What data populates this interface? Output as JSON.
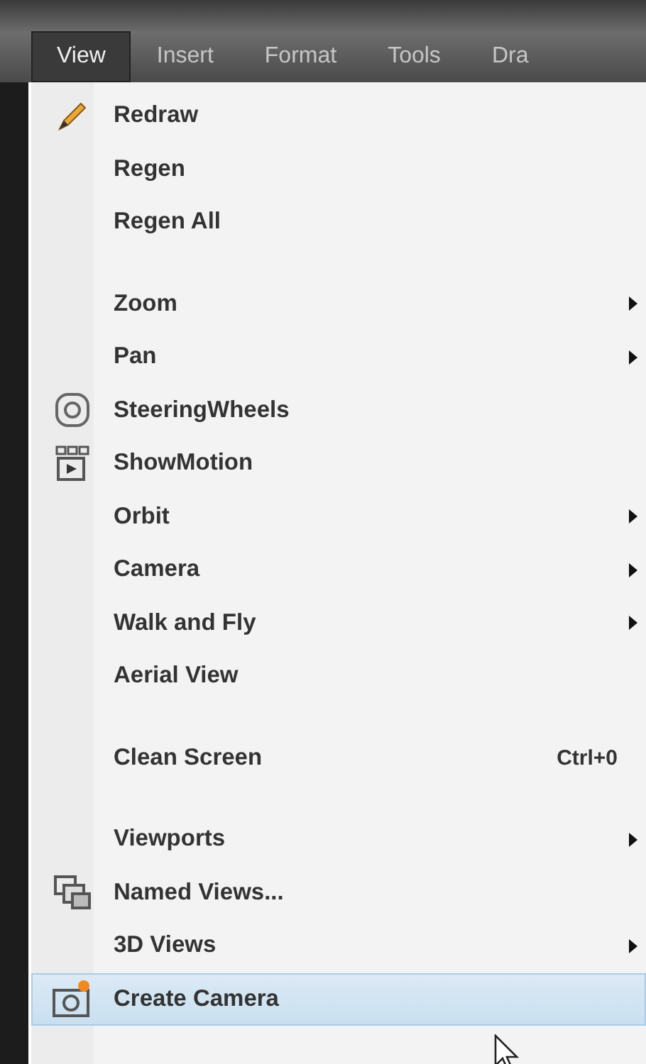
{
  "menubar": [
    {
      "label": "View",
      "selected": true
    },
    {
      "label": "Insert",
      "selected": false
    },
    {
      "label": "Format",
      "selected": false
    },
    {
      "label": "Tools",
      "selected": false
    },
    {
      "label": "Dra",
      "selected": false
    }
  ],
  "menu": {
    "items": [
      {
        "kind": "item",
        "label": "Redraw",
        "submenu": false,
        "selected": false
      },
      {
        "kind": "item",
        "label": "Regen",
        "submenu": false,
        "selected": false
      },
      {
        "kind": "item",
        "label": "Regen All",
        "submenu": false,
        "selected": false
      },
      {
        "kind": "separator"
      },
      {
        "kind": "item",
        "label": "Zoom",
        "submenu": true,
        "selected": false
      },
      {
        "kind": "item",
        "label": "Pan",
        "submenu": true,
        "selected": false
      },
      {
        "kind": "item",
        "label": "SteeringWheels",
        "submenu": false,
        "selected": false
      },
      {
        "kind": "item",
        "label": "ShowMotion",
        "submenu": false,
        "selected": false
      },
      {
        "kind": "item",
        "label": "Orbit",
        "submenu": true,
        "selected": false
      },
      {
        "kind": "item",
        "label": "Camera",
        "submenu": true,
        "selected": false
      },
      {
        "kind": "item",
        "label": "Walk and Fly",
        "submenu": true,
        "selected": false
      },
      {
        "kind": "item",
        "label": "Aerial View",
        "submenu": false,
        "selected": false
      },
      {
        "kind": "separator"
      },
      {
        "kind": "item",
        "label": "Clean Screen",
        "shortcut": "Ctrl+0",
        "submenu": false,
        "selected": false
      },
      {
        "kind": "separator"
      },
      {
        "kind": "item",
        "label": "Viewports",
        "submenu": true,
        "selected": false
      },
      {
        "kind": "item",
        "label": "Named Views...",
        "submenu": false,
        "selected": false
      },
      {
        "kind": "item",
        "label": "3D Views",
        "submenu": true,
        "selected": false
      },
      {
        "kind": "item",
        "label": "Create Camera",
        "submenu": false,
        "selected": true
      }
    ]
  }
}
